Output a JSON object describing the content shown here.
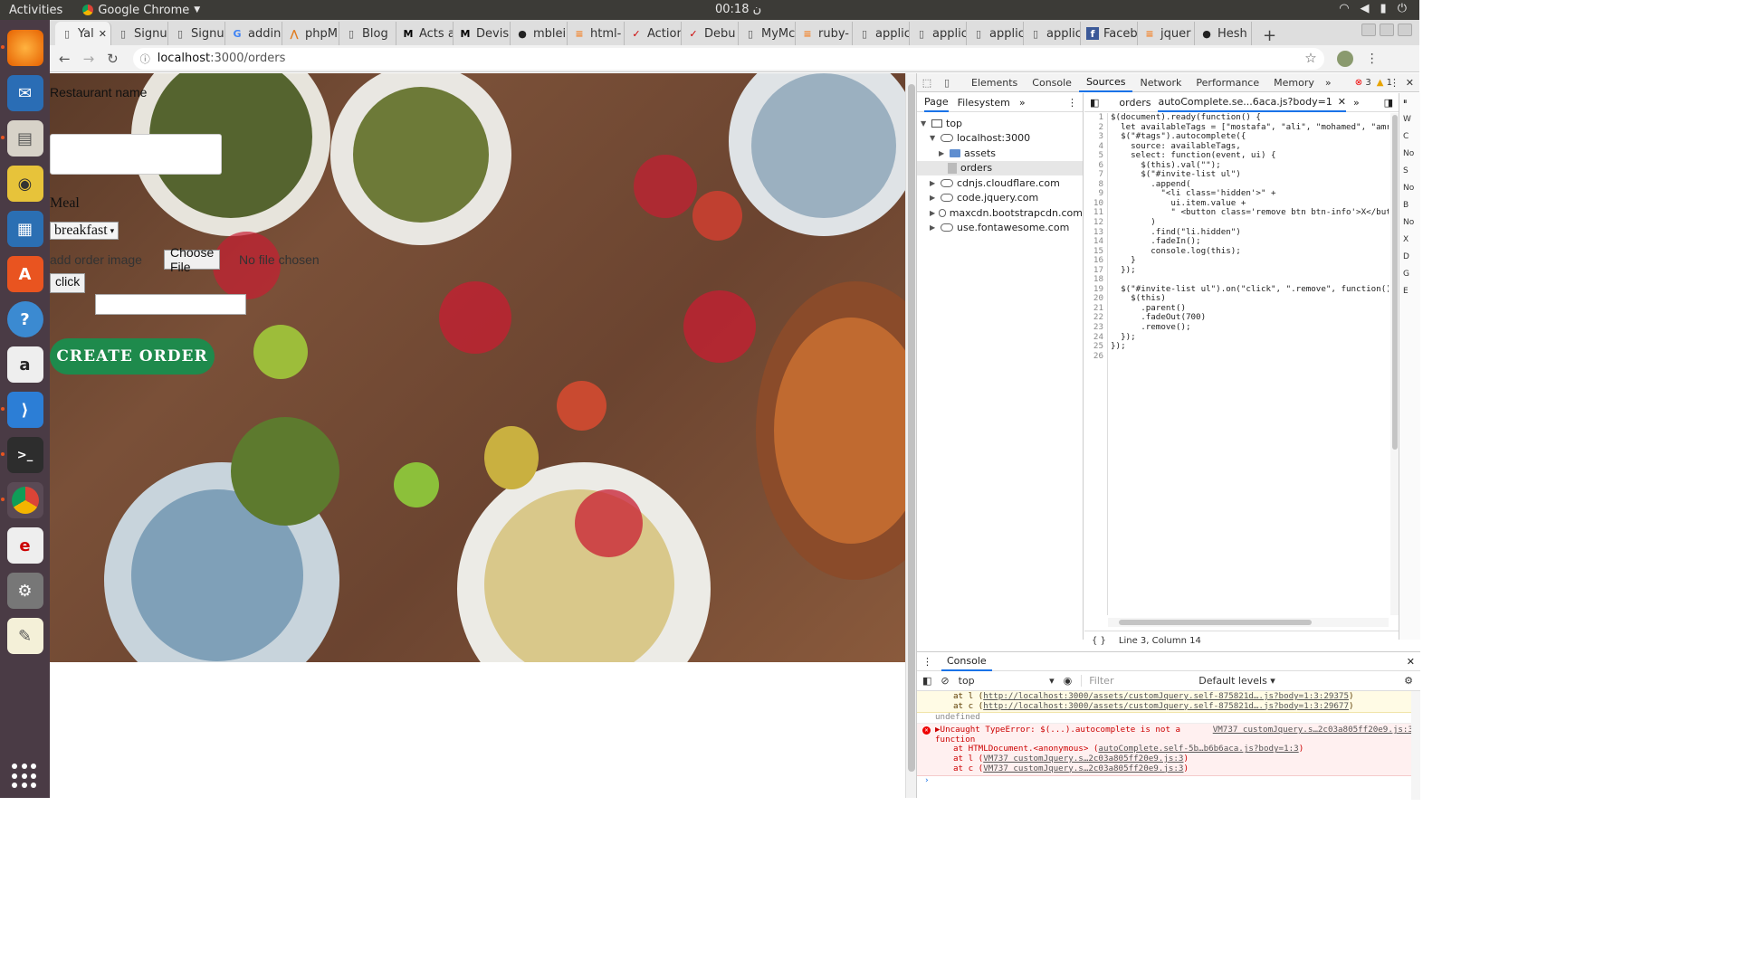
{
  "system": {
    "activities": "Activities",
    "app_name": "Google Chrome",
    "clock": "00:18 ن"
  },
  "tabs": [
    {
      "label": "Yal",
      "active": true,
      "favicon": "document-icon"
    },
    {
      "label": "Signu",
      "favicon": "document-icon"
    },
    {
      "label": "Signu",
      "favicon": "document-icon"
    },
    {
      "label": "addin",
      "favicon": "google-icon"
    },
    {
      "label": "phpM",
      "favicon": "phpmyadmin-icon"
    },
    {
      "label": "Blog",
      "favicon": "document-icon"
    },
    {
      "label": "Acts a",
      "favicon": "medium-icon"
    },
    {
      "label": "Devis",
      "favicon": "medium-icon"
    },
    {
      "label": "mblei",
      "favicon": "github-icon"
    },
    {
      "label": "html-",
      "favicon": "stackoverflow-icon"
    },
    {
      "label": "Action",
      "favicon": "rails-icon"
    },
    {
      "label": "Debu",
      "favicon": "rails-icon"
    },
    {
      "label": "MyMc",
      "favicon": "document-icon"
    },
    {
      "label": "ruby-",
      "favicon": "stackoverflow-icon"
    },
    {
      "label": "applic",
      "favicon": "document-icon"
    },
    {
      "label": "applic",
      "favicon": "document-icon"
    },
    {
      "label": "applic",
      "favicon": "document-icon"
    },
    {
      "label": "applic",
      "favicon": "document-icon"
    },
    {
      "label": "Faceb",
      "favicon": "facebook-icon"
    },
    {
      "label": "jquer",
      "favicon": "stackoverflow-icon"
    },
    {
      "label": "Hesh",
      "favicon": "github-icon"
    }
  ],
  "address": {
    "host": "localhost",
    "path": ":3000/orders"
  },
  "form": {
    "restaurant_label": "Restaurant name",
    "meal_label": "Meal",
    "meal_value": "breakfast",
    "image_label": "add order image",
    "choose_file": "Choose File",
    "no_file": "No file chosen",
    "click_button": "click",
    "create_order": "CREATE ORDER"
  },
  "devtools": {
    "panels": [
      "Elements",
      "Console",
      "Sources",
      "Network",
      "Performance",
      "Memory"
    ],
    "active_panel": "Sources",
    "errors": "3",
    "warnings": "1",
    "nav_tabs": [
      "Page",
      "Filesystem"
    ],
    "tree": {
      "top": "top",
      "origin": "localhost:3000",
      "assets": "assets",
      "orders": "orders",
      "cdnjs": "cdnjs.cloudflare.com",
      "jquery": "code.jquery.com",
      "bootstrap": "maxcdn.bootstrapcdn.com",
      "fontawesome": "use.fontawesome.com"
    },
    "editor_tabs": {
      "first": "orders",
      "second": "autoComplete.se...6aca.js?body=1"
    },
    "code_lines": [
      "$(document).ready(function() {",
      "  let availableTags = [\"mostafa\", \"ali\", \"mohamed\", \"amr\"",
      "  $(\"#tags\").autocomplete({",
      "    source: availableTags,",
      "    select: function(event, ui) {",
      "      $(this).val(\"\");",
      "      $(\"#invite-list ul\")",
      "        .append(",
      "          \"<li class='hidden'>\" +",
      "            ui.item.value +",
      "            \" <button class='remove btn btn-info'>X</butt",
      "        )",
      "        .find(\"li.hidden\")",
      "        .fadeIn();",
      "        console.log(this);",
      "    }",
      "  });",
      "",
      "  $(\"#invite-list ul\").on(\"click\", \".remove\", function()",
      "    $(this)",
      "      .parent()",
      "      .fadeOut(700)",
      "      .remove();",
      "  });",
      "});",
      ""
    ],
    "status": "Line 3, Column 14",
    "side_labels": [
      "W",
      "C",
      "No",
      "S",
      "No",
      "B",
      "No",
      "X",
      "D",
      "G",
      "E"
    ],
    "console": {
      "title": "Console",
      "context": "top",
      "filter_placeholder": "Filter",
      "levels": "Default levels",
      "warn_lines": [
        {
          "prefix": "at l (",
          "link": "http://localhost:3000/assets/customJquery.self-875821d….js?body=1:3:29375",
          "suffix": ")"
        },
        {
          "prefix": "at c (",
          "link": "http://localhost:3000/assets/customJquery.self-875821d….js?body=1:3:29677",
          "suffix": ")"
        }
      ],
      "undefined": "undefined",
      "error": {
        "message": "Uncaught TypeError: $(...).autocomplete is not a",
        "message2": "function",
        "location": "VM737 customJquery.s…2c03a805ff20e9.js:3",
        "stack": [
          {
            "prefix": "at HTMLDocument.<anonymous> (",
            "link": "autoComplete.self-5b…b6b6aca.js?body=1:3",
            "suffix": ")"
          },
          {
            "prefix": "at l (",
            "link": "VM737 customJquery.s…2c03a805ff20e9.js:3",
            "suffix": ")"
          },
          {
            "prefix": "at c (",
            "link": "VM737 customJquery.s…2c03a805ff20e9.js:3",
            "suffix": ")"
          }
        ]
      }
    }
  }
}
